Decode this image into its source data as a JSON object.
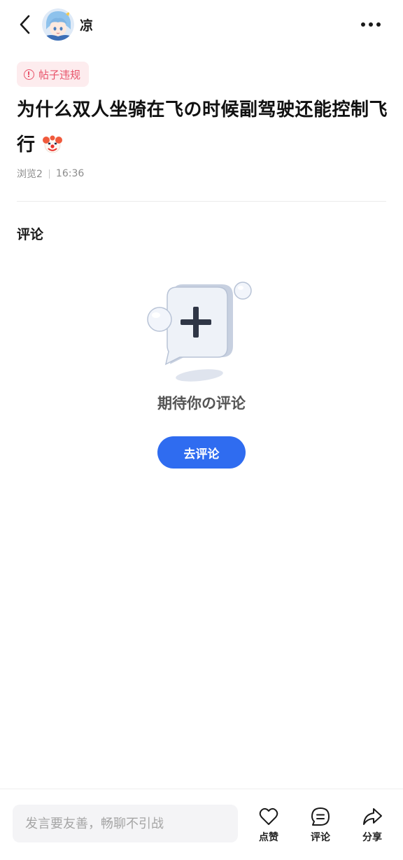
{
  "header": {
    "username": "凉",
    "back_icon": "chevron-left-icon",
    "more_icon": "more-horizontal-icon"
  },
  "post": {
    "violation_tag": "帖子违规",
    "title": "为什么双人坐骑在飞の时候副驾驶还能控制飞行",
    "title_emoji_icon": "clown-face-icon",
    "views": "浏览2",
    "time": "16:36"
  },
  "comments": {
    "heading": "评论",
    "empty_text": "期待你の评论",
    "go_comment_label": "去评论"
  },
  "bottom_bar": {
    "input_placeholder": "发言要友善，畅聊不引战",
    "like_label": "点赞",
    "comment_label": "评论",
    "share_label": "分享"
  },
  "colors": {
    "accent": "#2f6cf0",
    "violation": "#e8536a",
    "violation_bg": "#fdecee"
  }
}
